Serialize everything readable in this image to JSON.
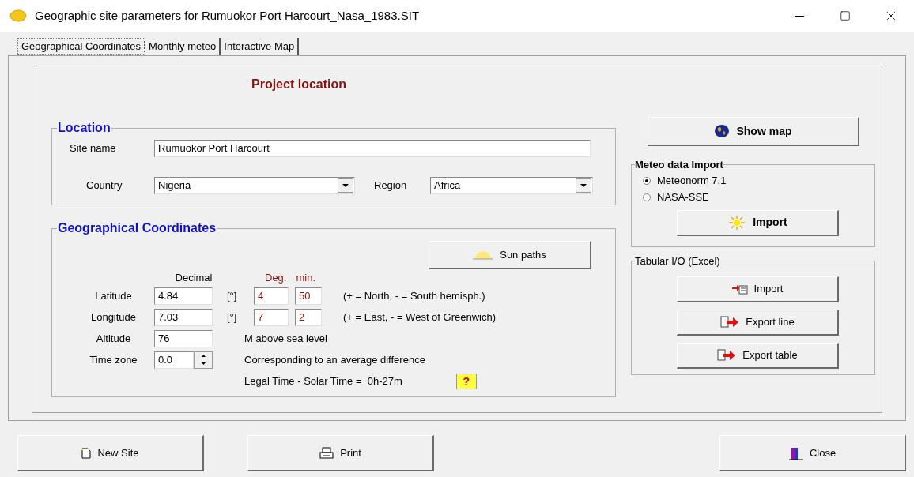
{
  "window": {
    "title": "Geographic site parameters for Rumuokor Port Harcourt_Nasa_1983.SIT"
  },
  "tabs": [
    {
      "label": "Geographical Coordinates",
      "selected": true
    },
    {
      "label": "Monthly meteo",
      "selected": false
    },
    {
      "label": "Interactive Map",
      "selected": false
    }
  ],
  "panel_heading": "Project location",
  "location": {
    "title": "Location",
    "site_name": {
      "label": "Site name",
      "value": "Rumuokor Port Harcourt"
    },
    "country": {
      "label": "Country",
      "value": "Nigeria"
    },
    "region": {
      "label": "Region",
      "value": "Africa"
    }
  },
  "coordinates": {
    "title": "Geographical Coordinates",
    "sun_paths_button": "Sun paths",
    "headers": {
      "decimal": "Decimal",
      "deg": "Deg.",
      "min": "min."
    },
    "rows": [
      {
        "kind": "angle",
        "label": "Latitude",
        "decimal": "4.84",
        "unit": "[°]",
        "deg": "4",
        "min": "50",
        "note": "(+ = North,  - = South hemisph.)"
      },
      {
        "kind": "angle",
        "label": "Longitude",
        "decimal": "7.03",
        "unit": "[°]",
        "deg": "7",
        "min": "2",
        "note": "(+ = East, - = West of Greenwich)"
      },
      {
        "kind": "plain",
        "label": "Altitude",
        "value": "76",
        "note": "M above sea level"
      },
      {
        "kind": "spin",
        "label": "Time zone",
        "value": "0.0",
        "note": "Corresponding to an average difference"
      }
    ],
    "legal_time": "Legal Time - Solar Time =  0h-27m",
    "help_button": "?"
  },
  "show_map_button": "Show map",
  "meteo_import": {
    "title": "Meteo data Import",
    "options": [
      {
        "label": "Meteonorm 7.1",
        "selected": true
      },
      {
        "label": "NASA-SSE",
        "selected": false
      }
    ],
    "import_button": "Import"
  },
  "tabular_io": {
    "title": "Tabular I/O (Excel)",
    "buttons": [
      {
        "kind": "import",
        "label": "Import"
      },
      {
        "kind": "export-line",
        "label": "Export line"
      },
      {
        "kind": "export-table",
        "label": "Export table"
      }
    ]
  },
  "footer_buttons": [
    {
      "kind": "new",
      "label": "New Site"
    },
    {
      "kind": "print",
      "label": "Print"
    },
    {
      "kind": "close",
      "label": "Close"
    }
  ]
}
